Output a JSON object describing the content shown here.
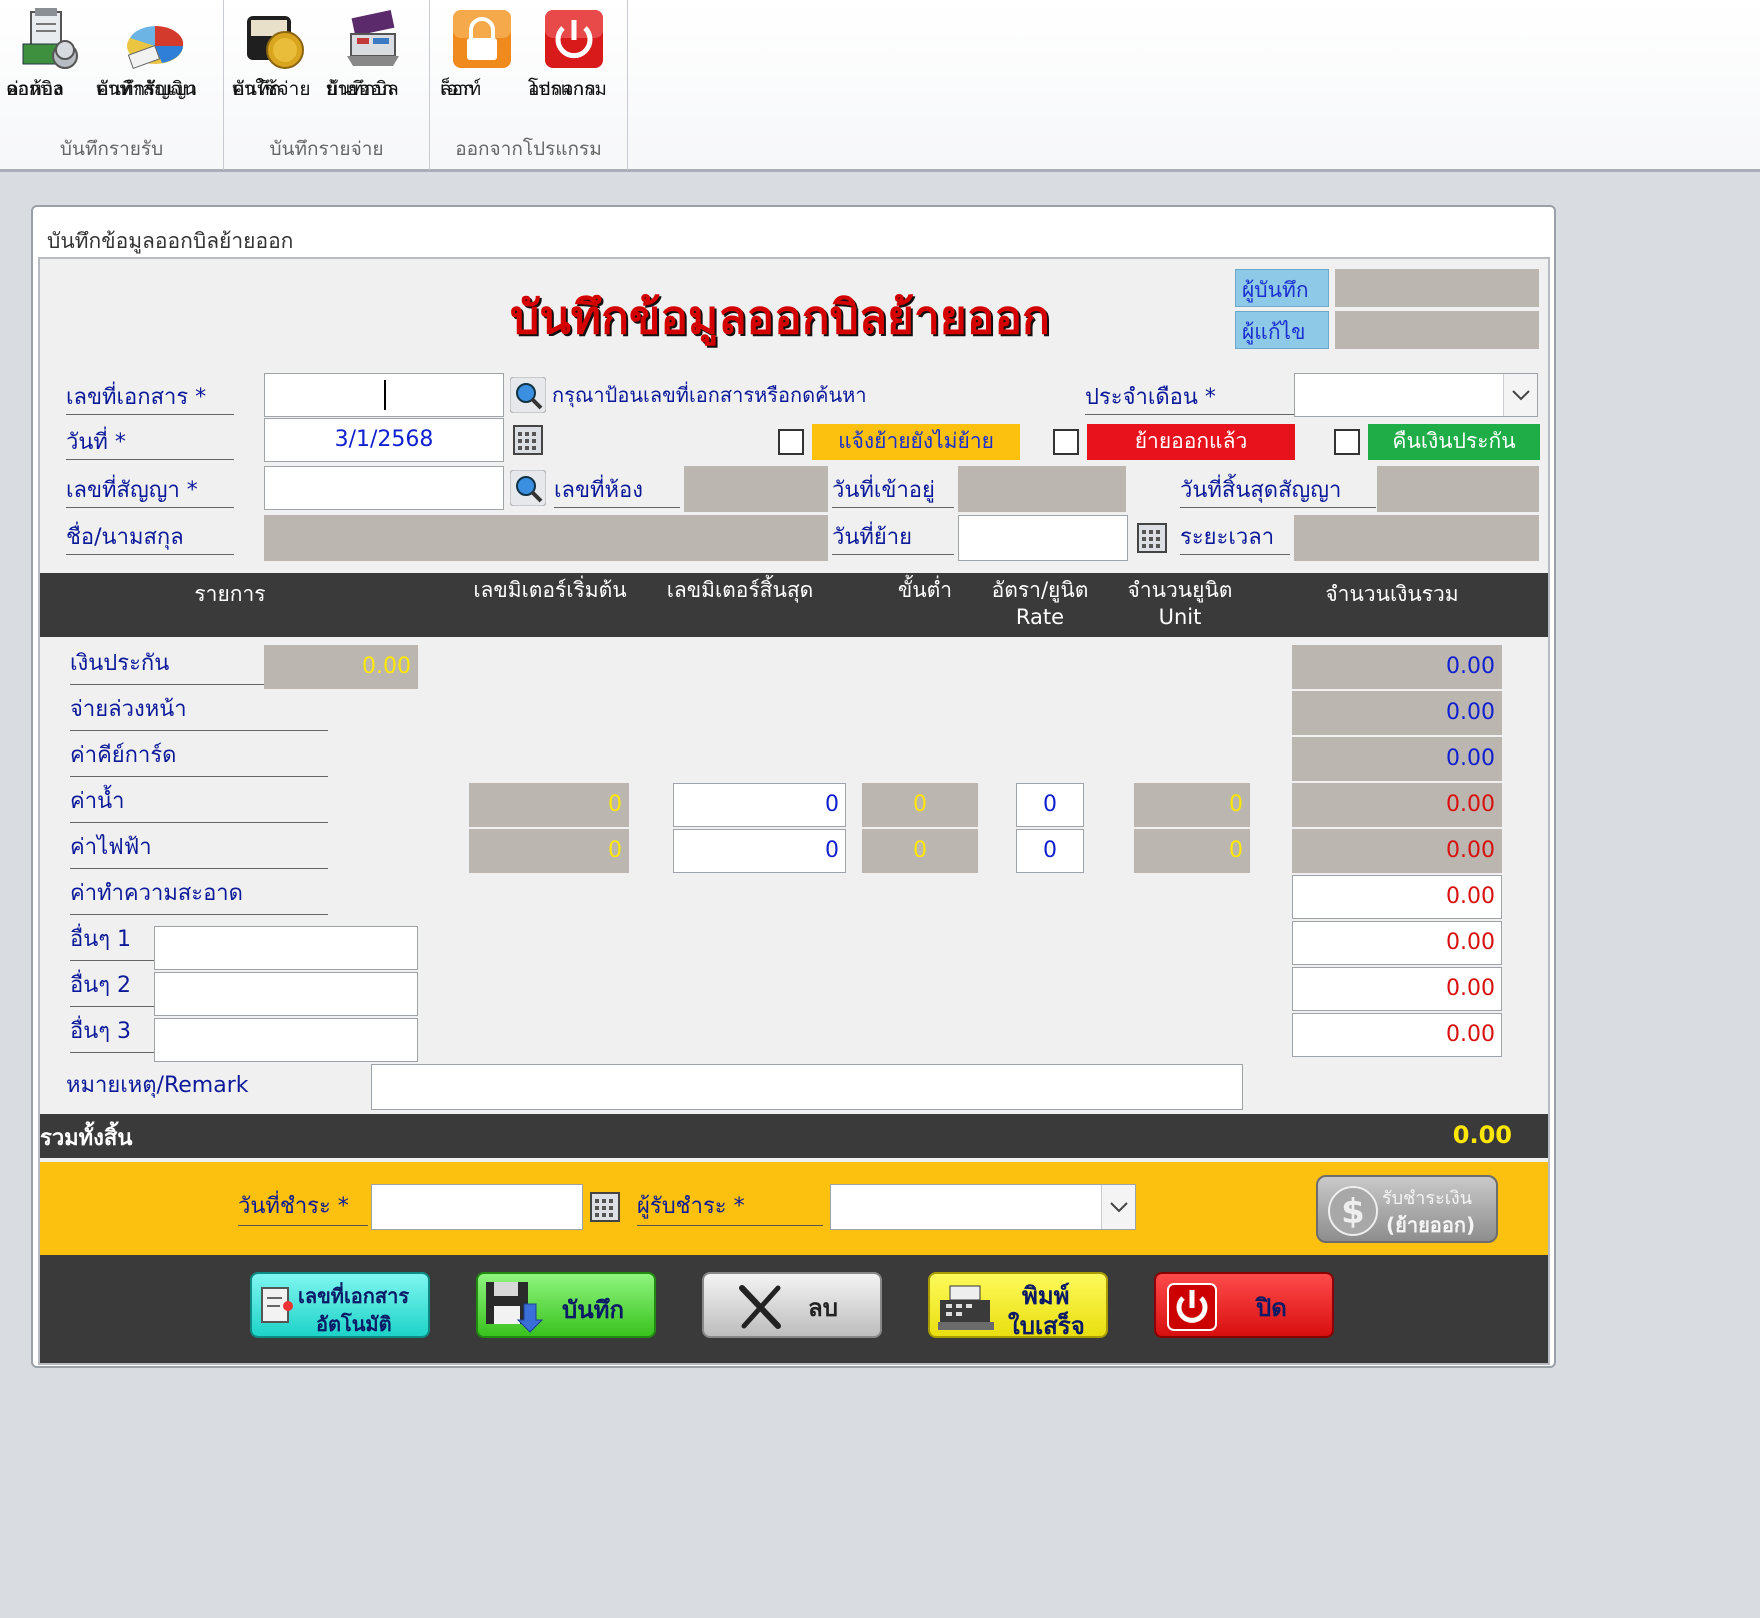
{
  "ribbon": {
    "groups": [
      {
        "name": "บันทึกรายรับ",
        "buttons": [
          {
            "line1": "ออกบิล",
            "line2": "ค่าห้อง",
            "icon": "bill-room-icon"
          },
          {
            "line1": "บันทึกรับเงิน",
            "line2": "ค่าทำสัญญา",
            "icon": "pie-chart-icon"
          }
        ]
      },
      {
        "name": "บันทึกรายจ่าย",
        "buttons": [
          {
            "line1": "บันทึก",
            "line2": "ค่าใช้จ่าย",
            "icon": "wallet-coin-icon"
          },
          {
            "line1": "บันทึกบิล",
            "line2": "ย้ายออก",
            "icon": "cash-register-icon"
          }
        ]
      },
      {
        "name": "ออกจากโปรแกรม",
        "buttons": [
          {
            "line1": "ล็อก",
            "line2": "เอาท์",
            "icon": "lock-icon"
          },
          {
            "line1": "ออกจาก",
            "line2": "โปรแกรม",
            "icon": "power-icon"
          }
        ]
      }
    ]
  },
  "window": {
    "caption": "บันทึกข้อมูลออกบิลย้ายออก"
  },
  "form": {
    "title": "บันทึกข้อมูลออกบิลย้ายออก",
    "recorder_label": "ผู้บันทึก",
    "editor_label": "ผู้แก้ไข",
    "doc_no_label": "เลขที่เอกสาร *",
    "doc_hint": "กรุณาป้อนเลขที่เอกสารหรือกดค้นหา",
    "month_label": "ประจำเดือน *",
    "date_label": "วันที่ *",
    "date_value": "3/1/2568",
    "status_pending": "แจ้งย้ายยังไม่ย้าย",
    "status_moved": "ย้ายออกแล้ว",
    "status_refund": "คืนเงินประกัน",
    "contract_label": "เลขที่สัญญา *",
    "room_label": "เลขที่ห้อง",
    "movein_label": "วันที่เข้าอยู่",
    "contract_end_label": "วันที่สิ้นสุดสัญญา",
    "name_label": "ชื่อ/นามสกุล",
    "moveout_label": "วันที่ย้าย",
    "duration_label": "ระยะเวลา"
  },
  "table": {
    "headers": {
      "item": "รายการ",
      "meter_start": "เลขมิเตอร์เริ่มต้น",
      "meter_end": "เลขมิเตอร์สิ้นสุด",
      "minimum": "ขั้นต่ำ",
      "rate": "อัตรา/ยูนิต",
      "rate_en": "Rate",
      "units": "จำนวนยูนิต",
      "units_en": "Unit",
      "total": "จำนวนเงินรวม"
    },
    "rows": [
      {
        "label": "เงินประกัน",
        "deposit": "0.00",
        "amount": "0.00"
      },
      {
        "label": "จ่ายล่วงหน้า",
        "amount": "0.00"
      },
      {
        "label": "ค่าคีย์การ์ด",
        "amount": "0.00"
      },
      {
        "label": "ค่าน้ำ",
        "meter_start": "0",
        "meter_end": "0",
        "minimum": "0",
        "rate": "0",
        "units": "0",
        "amount": "0.00"
      },
      {
        "label": "ค่าไฟฟ้า",
        "meter_start": "0",
        "meter_end": "0",
        "minimum": "0",
        "rate": "0",
        "units": "0",
        "amount": "0.00"
      },
      {
        "label": "ค่าทำความสะอาด",
        "amount": "0.00"
      },
      {
        "label": "อื่นๆ 1",
        "amount": "0.00"
      },
      {
        "label": "อื่นๆ 2",
        "amount": "0.00"
      },
      {
        "label": "อื่นๆ 3",
        "amount": "0.00"
      }
    ],
    "remark_label": "หมายเหตุ/Remark"
  },
  "total": {
    "label": "รวมทั้งสิ้น",
    "value": "0.00"
  },
  "payment": {
    "date_label": "วันที่ชำระ *",
    "receiver_label": "ผู้รับชำระ *",
    "receive_button": "รับชำระเงิน",
    "receive_button_sub": "(ย้ายออก)"
  },
  "buttons": {
    "auto_doc_line1": "เลขที่เอกสาร",
    "auto_doc_line2": "อัตโนมัติ",
    "save": "บันทึก",
    "delete": "ลบ",
    "print_line1": "พิมพ์",
    "print_line2": "ใบเสร็จ",
    "close": "ปิด"
  },
  "colors": {
    "title_red": "#d40000",
    "value_blue": "#1020d0",
    "value_red": "#d81010",
    "value_yellow": "#ffe800",
    "status_pending_bg": "#fcc10e",
    "status_moved_bg": "#e8121c",
    "status_refund_bg": "#1fad48",
    "band_dark": "#3a3a3a",
    "pay_band": "#fcc10e"
  }
}
